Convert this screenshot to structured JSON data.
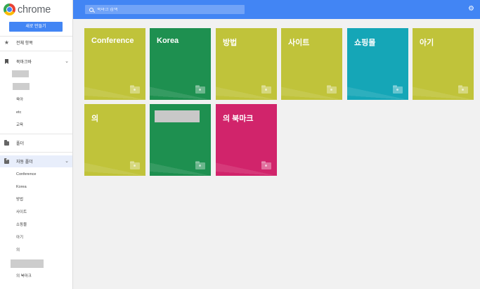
{
  "brand": {
    "name": "chrome"
  },
  "sidebar": {
    "new_folder_label": "새로 만들기",
    "all_items_label": "전체 항목",
    "bookmarks_label": "북마크바",
    "bookmark_children": [
      "",
      "",
      "육아",
      "etc",
      "교육"
    ],
    "folder_label": "폴더",
    "auto_folders_label": "자동 폴더",
    "auto_folder_children": [
      "Conference",
      "Korea",
      "방법",
      "사이트",
      "쇼핑몰",
      "아기",
      "의",
      "",
      "의 북마크"
    ]
  },
  "search": {
    "placeholder": "북마크 검색",
    "value": ""
  },
  "tiles": [
    {
      "label": "Conference",
      "color": "#c0c33a"
    },
    {
      "label": "Korea",
      "color": "#1e9050"
    },
    {
      "label": "방법",
      "color": "#c0c33a"
    },
    {
      "label": "사이트",
      "color": "#c0c33a"
    },
    {
      "label": "쇼핑몰",
      "color": "#15a6b7"
    },
    {
      "label": "아기",
      "color": "#c0c33a"
    },
    {
      "label": "의",
      "color": "#c0c33a"
    },
    {
      "label": "",
      "color": "#1e9050"
    },
    {
      "label": "의 북마크",
      "color": "#d1246b"
    }
  ],
  "icons": {
    "logo": "chrome-logo",
    "search": "search-icon",
    "settings": "gear-icon",
    "all_items": "star-icon",
    "bookmarks": "bookmark-icon",
    "folder": "folder-icon",
    "auto_folder": "auto-folder-icon",
    "expand": "chevron-down-icon"
  },
  "colors": {
    "accent": "#4285f4",
    "background": "#f1f1f1"
  }
}
